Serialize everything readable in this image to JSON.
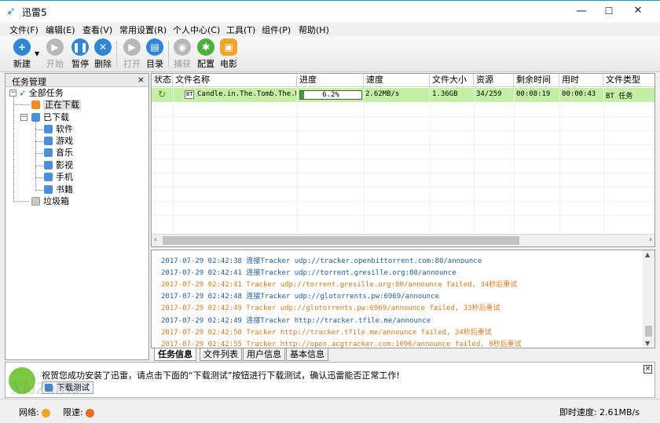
{
  "window": {
    "title": "迅雷5",
    "minimize": "—",
    "maximize": "☐",
    "close": "✕"
  },
  "menu": [
    "文件(F)",
    "编辑(E)",
    "查看(V)",
    "常用设置(R)",
    "个人中心(C)",
    "工具(T)",
    "组件(P)",
    "帮助(H)"
  ],
  "toolbar": {
    "new": "新建",
    "start": "开始",
    "pause": "暂停",
    "delete": "删除",
    "open": "打开",
    "directory": "目录",
    "capture": "捕获",
    "config": "配置",
    "movie": "电影"
  },
  "left_pane": {
    "title": "任务管理",
    "close": "×",
    "all_tasks": "全部任务",
    "downloading": "正在下载",
    "downloaded": "已下载",
    "categories": [
      "软件",
      "游戏",
      "音乐",
      "影视",
      "手机",
      "书籍"
    ],
    "trash": "垃圾箱"
  },
  "task_table": {
    "columns": [
      "状态",
      "文件名称",
      "进度",
      "速度",
      "文件大小",
      "资源",
      "剩余时间",
      "用时",
      "文件类型"
    ],
    "rows": [
      {
        "name": "Candle.in.The.Tomb.The.W",
        "badge": "BT",
        "progress": "6.2%",
        "progress_value": 0.062,
        "speed": "2.62MB/s",
        "size": "1.36GB",
        "resources": "34/259",
        "remaining": "00:08:19",
        "elapsed": "00:00:43",
        "type": "BT 任务"
      }
    ]
  },
  "log": [
    {
      "time": "2017-07-29 02:42:38",
      "text": "连接Tracker udp://tracker.openbittorrent.com:80/announce",
      "level": "info"
    },
    {
      "time": "2017-07-29 02:42:41",
      "text": "连接Tracker udp://torrent.gresille.org:80/announce",
      "level": "info"
    },
    {
      "time": "2017-07-29 02:42:41",
      "text": "Tracker udp://torrent.gresille.org:80/announce failed, 34秒后重试",
      "level": "warn"
    },
    {
      "time": "2017-07-29 02:42:48",
      "text": "连接Tracker udp://glotorrents.pw:6969/announce",
      "level": "info"
    },
    {
      "time": "2017-07-29 02:42:49",
      "text": "Tracker udp://glotorrents.pw:6969/announce failed, 33秒后重试",
      "level": "warn"
    },
    {
      "time": "2017-07-29 02:42:49",
      "text": "连接Tracker http://tracker.tfile.me/announce",
      "level": "info"
    },
    {
      "time": "2017-07-29 02:42:50",
      "text": "Tracker http://tracker.tfile.me/announce failed, 34秒后重试",
      "level": "warn"
    },
    {
      "time": "2017-07-29 02:42:55",
      "text": "Tracker http://open.acgtracker.com:1096/announce failed, 8秒后重试",
      "level": "warn"
    }
  ],
  "tabs": [
    "任务信息",
    "文件列表",
    "用户信息",
    "基本信息"
  ],
  "notice": {
    "message": "祝贺您成功安装了迅雷，请点击下面的“下载测试”按钮进行下载测试，确认迅雷能否正常工作!",
    "button": "下载测试",
    "close": "×"
  },
  "status": {
    "network_label": "网络:",
    "speed_limit_label": "限速:",
    "instant_speed": "即时速度: 2.61MB/s"
  },
  "watermark": "XiaZaiBa",
  "colors": {
    "row_highlight": "#c6efa6",
    "log_info": "#1d5fa8",
    "log_warn": "#e07818",
    "accent_blue": "#2b8fd6"
  }
}
